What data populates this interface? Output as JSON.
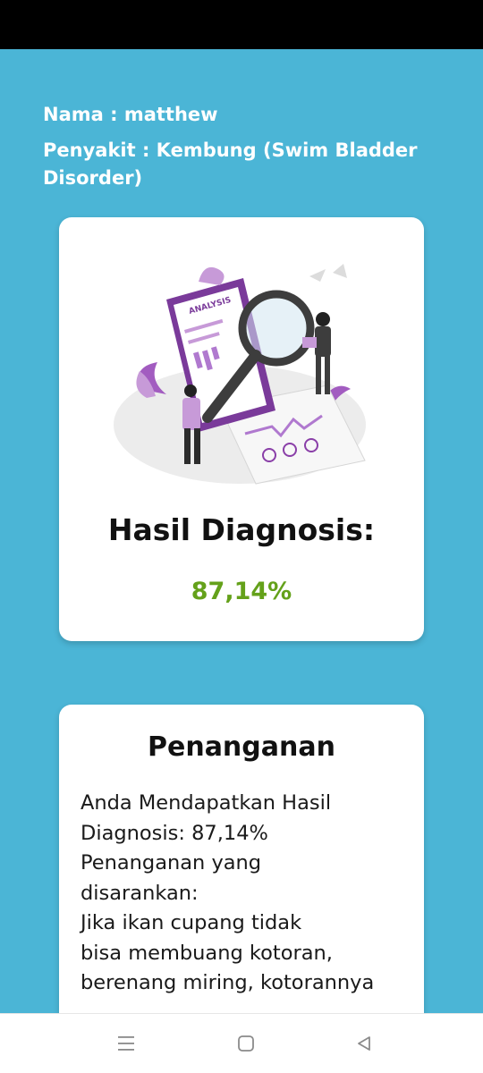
{
  "patient": {
    "name_line": "Nama : matthew",
    "disease_line": "Penyakit : Kembung (Swim Bladder Disorder)"
  },
  "result_card": {
    "illustration_label": "ANALYSIS",
    "title": "Hasil Diagnosis:",
    "percentage": "87,14%"
  },
  "treatment_card": {
    "title": "Penanganan",
    "body": "Anda Mendapatkan Hasil\nDiagnosis: 87,14%\nPenanganan yang\ndisarankan:\nJika ikan cupang tidak\nbisa membuang kotoran,\nberenang miring, kotorannya"
  },
  "navigation": {
    "icons": [
      "menu-icon",
      "home-square-icon",
      "back-triangle-icon"
    ]
  },
  "colors": {
    "background": "#4bb5d6",
    "card": "#ffffff",
    "percentage": "#64a11a",
    "illustration_accent": "#8a3fa8"
  }
}
